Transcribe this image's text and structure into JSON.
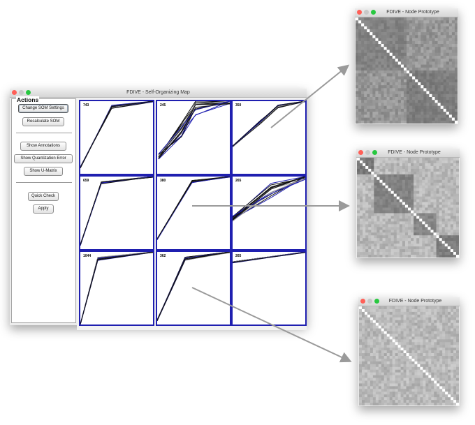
{
  "som_window": {
    "title": "FDIVE - Self-Organizing Map",
    "actions_label": "Actions",
    "buttons": {
      "change_settings": "Change SOM Settings",
      "recalculate": "Recalculate SOM",
      "show_annotations": "Show Annotations",
      "show_quant_error": "Show Quantization Error",
      "show_umatrix": "Show U-Matrix",
      "quick_check": "Quick Check",
      "apply": "Apply"
    },
    "grid_counts": [
      "743",
      "245",
      "350",
      "659",
      "380",
      "265",
      "1044",
      "362",
      "265"
    ]
  },
  "prototype_windows": [
    {
      "title": "FDIVE - Node Prototype"
    },
    {
      "title": "FDIVE - Node Prototype"
    },
    {
      "title": "FDIVE - Node Prototype"
    }
  ],
  "colors": {
    "cell_border": "#1f1fb0",
    "arrow": "#9a9a9a",
    "traffic_red": "#ff5f57",
    "traffic_green": "#28c840"
  }
}
